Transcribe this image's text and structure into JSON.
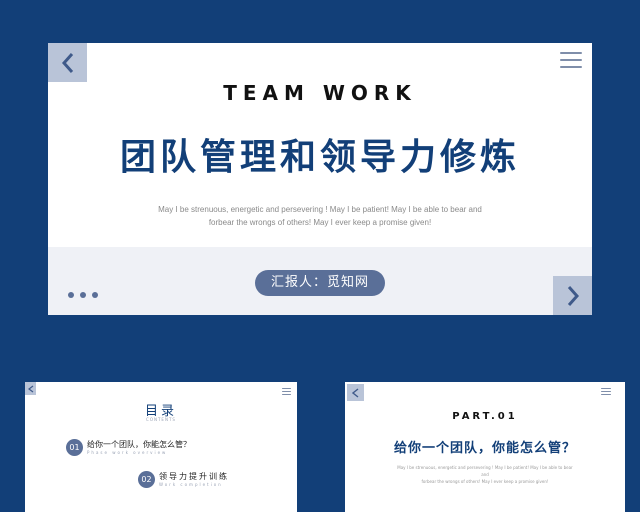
{
  "main_slide": {
    "title_en": "TEAM WORK",
    "title_cn": "团队管理和领导力修炼",
    "description_line1": "May I be strenuous, energetic and persevering ! May I be patient! May I be able to bear and",
    "description_line2": "forbear the wrongs of others! May I ever keep a promise given!",
    "presenter": "汇报人：觅知网",
    "icons": {
      "prev": "chevron-left-icon",
      "next": "chevron-right-icon",
      "menu": "menu-icon"
    }
  },
  "contents_slide": {
    "title": "目录",
    "subtitle": "CONTENTS",
    "items": [
      {
        "num": "01",
        "label": "给你一个团队，你能怎么管？",
        "en": "Phase work overview"
      },
      {
        "num": "02",
        "label": "领导力提升训练",
        "en": "Work completion"
      }
    ]
  },
  "part_slide": {
    "part": "PART.01",
    "title": "给你一个团队，你能怎么管？",
    "description_line1": "May I be strenuous, energetic and persevering ! May I be patient! May I be able to bear and",
    "description_line2": "forbear the wrongs of others! May I ever keep a promise given!"
  },
  "colors": {
    "background": "#123f78",
    "accent": "#5a6f98",
    "nav_square": "#b9c4d8",
    "band": "#eff1f6"
  }
}
